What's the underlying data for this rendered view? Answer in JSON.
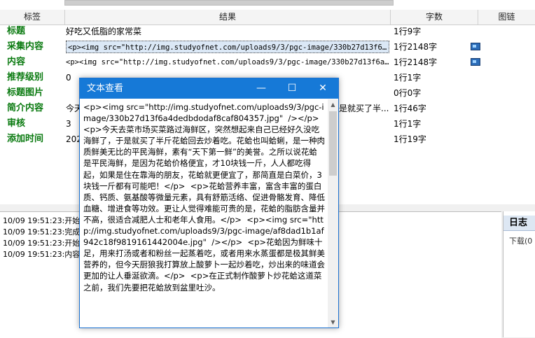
{
  "columns": {
    "label": "标签",
    "result": "结果",
    "chars": "字数",
    "image_link": "图链"
  },
  "rows": [
    {
      "label": "标题",
      "value": "好吃又低脂的家常菜",
      "count": "1行9字",
      "has_icon": false,
      "selected": false,
      "mono": false
    },
    {
      "label": "采集内容",
      "value": "<p><img src=\"http://img.studyofnet.com/uploads9/3/pgc-image/330b27d13f6a4...",
      "count": "1行2148字",
      "has_icon": true,
      "selected": true,
      "mono": true
    },
    {
      "label": "内容",
      "value": "<p><img src=\"http://img.studyofnet.com/uploads9/3/pgc-image/330b27d13f6a4d...",
      "count": "1行2148字",
      "has_icon": true,
      "selected": false,
      "mono": true
    },
    {
      "label": "推荐级别",
      "value": "0",
      "count": "1行1字",
      "has_icon": false,
      "selected": false,
      "mono": false
    },
    {
      "label": "标题图片",
      "value": "",
      "count": "0行0字",
      "has_icon": false,
      "selected": false,
      "mono": false
    },
    {
      "label": "简介内容",
      "value": "今天",
      "value_right": "是就买了半...",
      "count": "1行46字",
      "has_icon": false,
      "selected": false,
      "mono": false
    },
    {
      "label": "审核",
      "value": "3",
      "count": "1行1字",
      "has_icon": false,
      "selected": false,
      "mono": false
    },
    {
      "label": "添加时间",
      "value": "202",
      "count": "1行19字",
      "has_icon": false,
      "selected": false,
      "mono": false
    }
  ],
  "log": {
    "lines": [
      "10/09 19:51:23:开始",
      "10/09 19:51:23:完成",
      "10/09 19:51:23:开始",
      "10/09 19:51:23:内容"
    ]
  },
  "side": {
    "tab": "日志",
    "sub": "下载(0"
  },
  "dialog": {
    "title": "文本查看",
    "minimize": "—",
    "maximize": "☐",
    "close": "✕",
    "text": "<p><img src=\"http://img.studyofnet.com/uploads9/3/pgc-image/330b27d13f6a4dedbdodaf8caf804357.jpg\"  /></p>  <p>今天去菜市场买菜路过海鲜区，突然想起来自己已经好久没吃海鲜了，于是就买了半斤花蛤回去炒着吃。花蛤也叫蛤蜊，是一种肉质鲜美无比的平民海鲜，素有“天下第一鲜”的美誉。之所以说花蛤是平民海鲜，是因为花蛤价格便宜，才10块钱一斤，人人都吃得起，如果是住在靠海的朋友，花蛤就更便宜了，那简直是白菜价，3块钱一斤都有可能吧！</p>  <p>花蛤营养丰富，富含丰富的蛋白质、钙质、氨基酸等微量元素，具有舒筋活络、促进骨骼发育、降低血糖、增进食等功效。更让人觉得难能可贵的是，花蛤的脂肪含量并不高，很适合减肥人士和老年人食用。</p>  <p><img src=\"http://img.studyofnet.com/uploads9/3/pgc-image/af8dad1b1af942c18f9819161442004e.jpg\"  /></p>  <p>花蛤因为鲜味十足，用来打汤或者和粉丝一起蒸着吃，或者用来水蒸蛋都是极其鲜美营养的，但今天厨狼我打算放上酸萝卜一起炒着吃，炒出来的味道会更加的让人垂涎欲滴。</p>  <p>在正式制作酸萝卜炒花蛤这道菜之前，我们先要把花蛤放到盆里吐沙。"
  },
  "colors": {
    "label_green": "#0a7a10",
    "title_bar": "#1679d7",
    "selection": "#dbe8f6"
  }
}
